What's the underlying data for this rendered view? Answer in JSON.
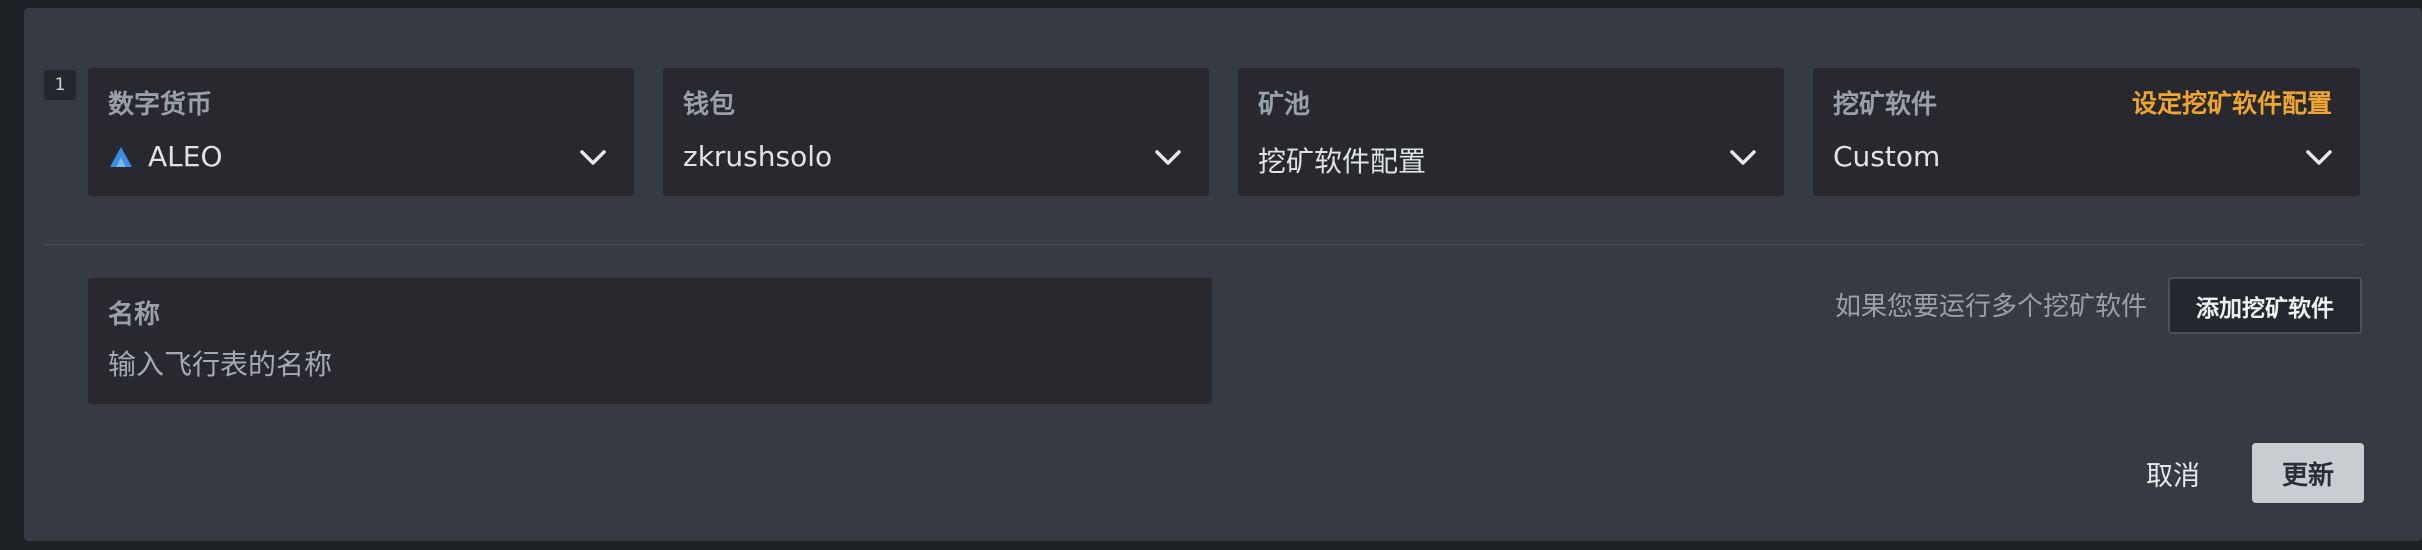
{
  "row_index": "1",
  "fields": {
    "currency": {
      "label": "数字货币",
      "value": "ALEO",
      "icon": "aleo-logo-icon"
    },
    "wallet": {
      "label": "钱包",
      "value": "zkrushsolo"
    },
    "pool": {
      "label": "矿池",
      "value": "挖矿软件配置"
    },
    "miner": {
      "label": "挖矿软件",
      "value": "Custom",
      "config_link": "设定挖矿软件配置"
    }
  },
  "name_field": {
    "label": "名称",
    "placeholder": "输入飞行表的名称"
  },
  "add_miner": {
    "hint": "如果您要运行多个挖矿软件",
    "button": "添加挖矿软件"
  },
  "actions": {
    "cancel": "取消",
    "update": "更新"
  },
  "colors": {
    "accent": "#f0a531",
    "panel_bg": "#363b43",
    "field_bg": "#27292e",
    "aleo_blue": "#3a8ee6"
  }
}
